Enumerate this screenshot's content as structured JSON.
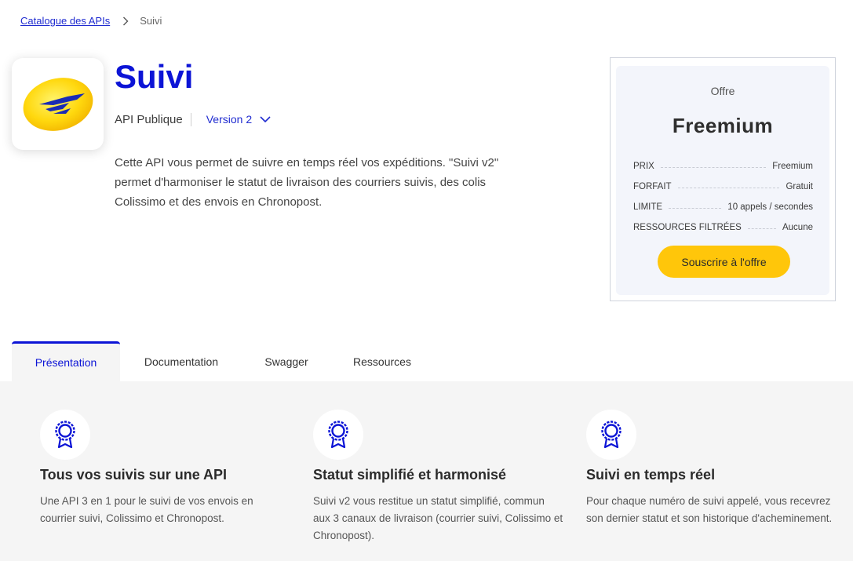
{
  "breadcrumb": {
    "parent": "Catalogue des APIs",
    "current": "Suivi"
  },
  "api": {
    "title": "Suivi",
    "visibility": "API Publique",
    "version": "Version 2",
    "description": "Cette API vous permet de suivre en temps réel vos expéditions. \"Suivi v2\" permet d'harmoniser le statut de livraison des courriers suivis, des colis Colissimo et des envois en Chronopost."
  },
  "offer": {
    "label": "Offre",
    "name": "Freemium",
    "rows": [
      {
        "key": "PRIX",
        "value": "Freemium"
      },
      {
        "key": "FORFAIT",
        "value": "Gratuit"
      },
      {
        "key": "LIMITE",
        "value": "10 appels / secondes"
      },
      {
        "key": "RESSOURCES FILTRÉES",
        "value": "Aucune"
      }
    ],
    "subscribe_label": "Souscrire à l'offre"
  },
  "tabs": [
    {
      "label": "Présentation",
      "active": true
    },
    {
      "label": "Documentation",
      "active": false
    },
    {
      "label": "Swagger",
      "active": false
    },
    {
      "label": "Ressources",
      "active": false
    }
  ],
  "features": [
    {
      "icon": "award-icon",
      "title": "Tous vos suivis sur une API",
      "text": "Une API 3 en 1 pour le suivi de vos envois en courrier suivi, Colissimo et Chronopost."
    },
    {
      "icon": "award-icon",
      "title": "Statut simplifié et harmonisé",
      "text": "Suivi v2 vous restitue un statut simplifié, commun aux 3 canaux de livraison (courrier suivi, Colissimo et Chronopost)."
    },
    {
      "icon": "award-icon",
      "title": "Suivi en temps réel",
      "text": "Pour chaque numéro de suivi appelé, vous recevrez son dernier statut et son historique d'acheminement."
    }
  ],
  "colors": {
    "brand_blue": "#0c14d6",
    "link_blue": "#1f2bd0",
    "accent_yellow": "#ffc60a",
    "panel_bg": "#f3f5fb",
    "section_bg": "#f5f5f5"
  }
}
